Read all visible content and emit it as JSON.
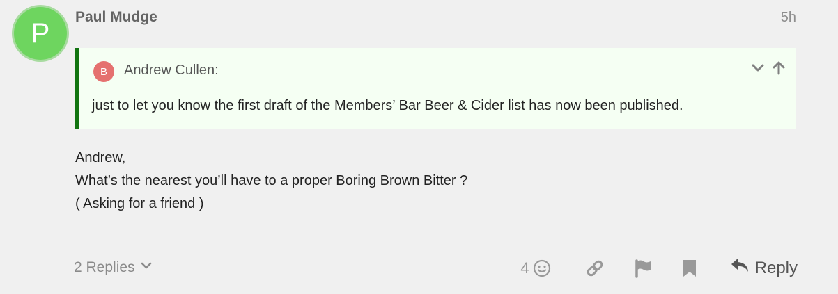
{
  "post": {
    "author": "Paul Mudge",
    "avatar_letter": "P",
    "age": "5h",
    "quote": {
      "avatar_letter": "B",
      "author": "Andrew Cullen:",
      "text": "just to let you know the first draft of the Members’ Bar Beer & Cider list has now been published."
    },
    "body": [
      "Andrew,",
      "What’s the nearest you’ll have to a proper Boring Brown Bitter ?",
      "( Asking for a friend )"
    ],
    "replies_label": "2 Replies",
    "like_count": "4",
    "reply_label": "Reply"
  },
  "colors": {
    "avatar": "#6ed55f",
    "quote_avatar": "#e5716f",
    "quote_border": "#117310",
    "quote_bg": "#f5fff3"
  }
}
